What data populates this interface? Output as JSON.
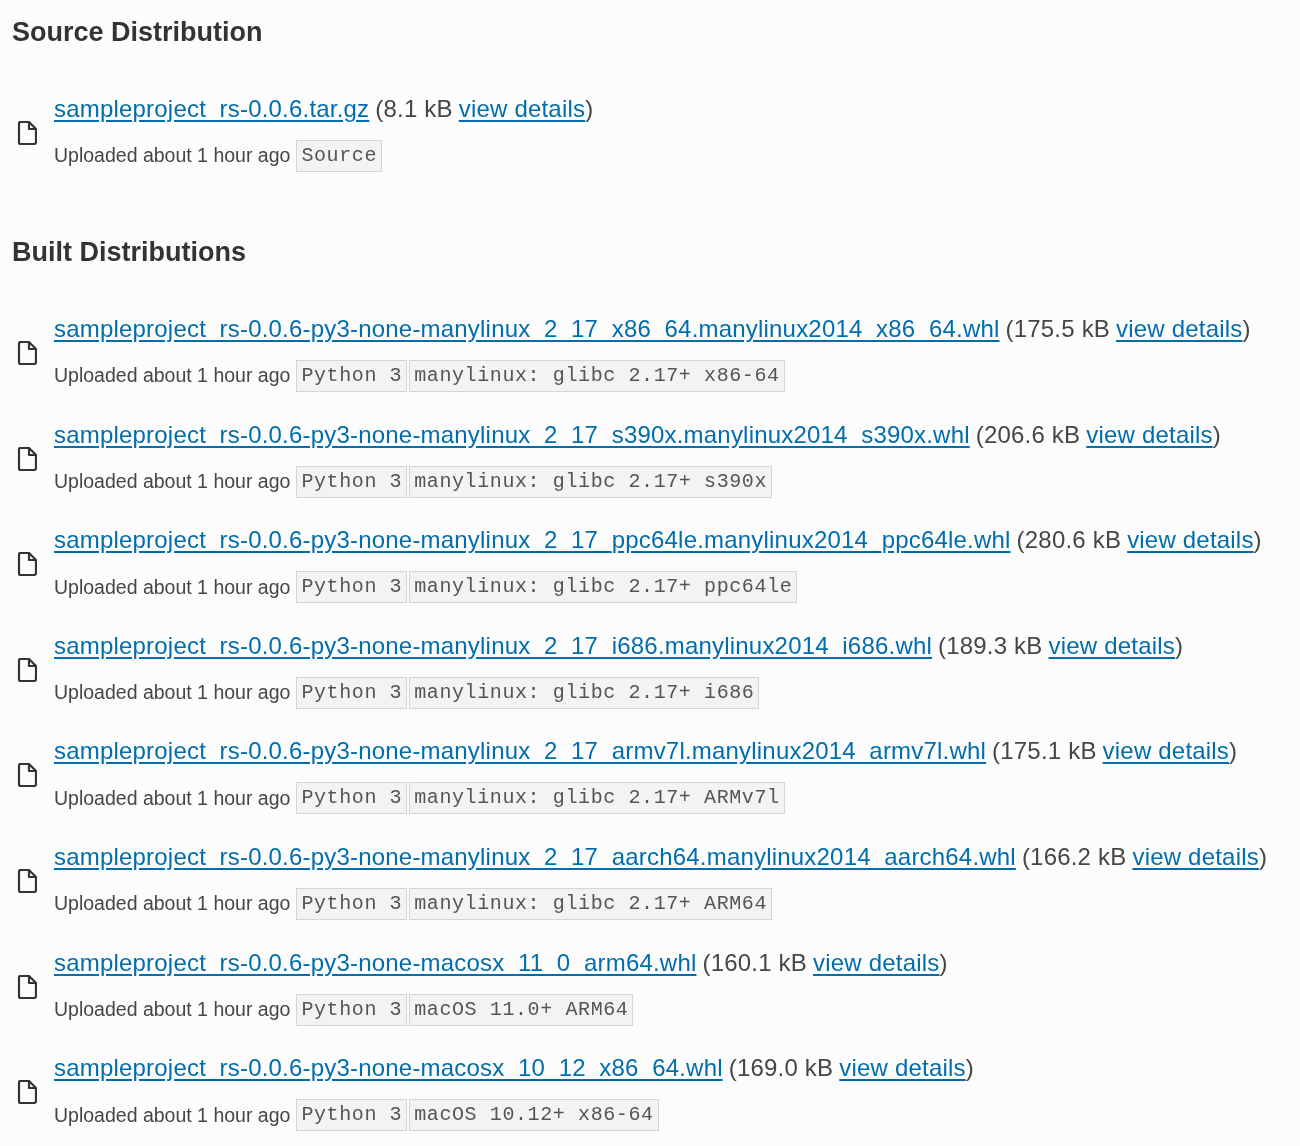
{
  "sections": [
    {
      "title": "Source Distribution",
      "files": [
        {
          "filename": "sampleproject_rs-0.0.6.tar.gz",
          "size": "(8.1 kB",
          "details": "view details",
          "close": ")",
          "uploaded": "Uploaded about 1 hour ago",
          "tags": [
            "Source"
          ]
        }
      ]
    },
    {
      "title": "Built Distributions",
      "files": [
        {
          "filename": "sampleproject_rs-0.0.6-py3-none-manylinux_2_17_x86_64.manylinux2014_x86_64.whl",
          "size": "(175.5 kB",
          "details": "view details",
          "close": ")",
          "uploaded": "Uploaded about 1 hour ago",
          "tags": [
            "Python 3",
            "manylinux: glibc 2.17+ x86-64"
          ]
        },
        {
          "filename": "sampleproject_rs-0.0.6-py3-none-manylinux_2_17_s390x.manylinux2014_s390x.whl",
          "size": "(206.6 kB",
          "details": "view details",
          "close": ")",
          "uploaded": "Uploaded about 1 hour ago",
          "tags": [
            "Python 3",
            "manylinux: glibc 2.17+ s390x"
          ]
        },
        {
          "filename": "sampleproject_rs-0.0.6-py3-none-manylinux_2_17_ppc64le.manylinux2014_ppc64le.whl",
          "size": "(280.6 kB",
          "details": "view details",
          "close": ")",
          "uploaded": "Uploaded about 1 hour ago",
          "tags": [
            "Python 3",
            "manylinux: glibc 2.17+ ppc64le"
          ]
        },
        {
          "filename": "sampleproject_rs-0.0.6-py3-none-manylinux_2_17_i686.manylinux2014_i686.whl",
          "size": "(189.3 kB",
          "details": "view details",
          "close": ")",
          "uploaded": "Uploaded about 1 hour ago",
          "tags": [
            "Python 3",
            "manylinux: glibc 2.17+ i686"
          ]
        },
        {
          "filename": "sampleproject_rs-0.0.6-py3-none-manylinux_2_17_armv7l.manylinux2014_armv7l.whl",
          "size": "(175.1 kB",
          "details": "view details",
          "close": ")",
          "uploaded": "Uploaded about 1 hour ago",
          "tags": [
            "Python 3",
            "manylinux: glibc 2.17+ ARMv7l"
          ]
        },
        {
          "filename": "sampleproject_rs-0.0.6-py3-none-manylinux_2_17_aarch64.manylinux2014_aarch64.whl",
          "size": "(166.2 kB",
          "details": "view details",
          "close": ")",
          "uploaded": "Uploaded about 1 hour ago",
          "tags": [
            "Python 3",
            "manylinux: glibc 2.17+ ARM64"
          ]
        },
        {
          "filename": "sampleproject_rs-0.0.6-py3-none-macosx_11_0_arm64.whl",
          "size": "(160.1 kB",
          "details": "view details",
          "close": ")",
          "uploaded": "Uploaded about 1 hour ago",
          "tags": [
            "Python 3",
            "macOS 11.0+ ARM64"
          ]
        },
        {
          "filename": "sampleproject_rs-0.0.6-py3-none-macosx_10_12_x86_64.whl",
          "size": "(169.0 kB",
          "details": "view details",
          "close": ")",
          "uploaded": "Uploaded about 1 hour ago",
          "tags": [
            "Python 3",
            "macOS 10.12+ x86-64"
          ]
        }
      ]
    }
  ]
}
